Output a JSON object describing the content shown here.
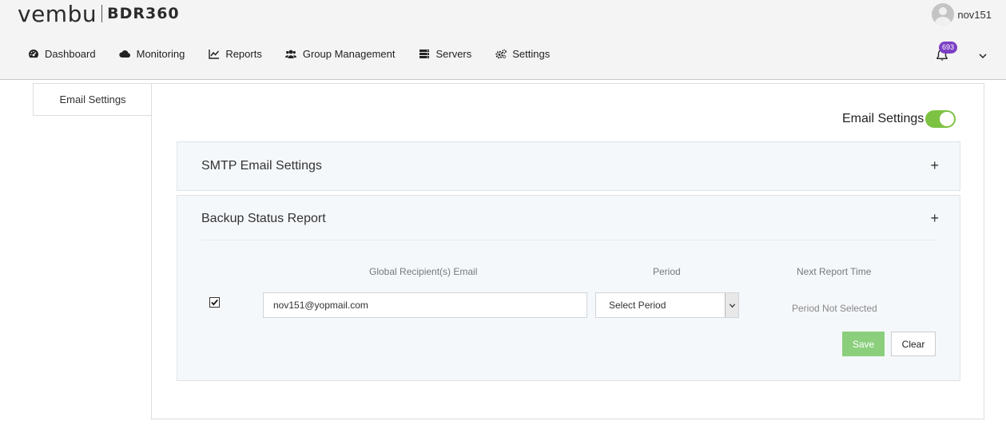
{
  "brand": {
    "logo": "vembu",
    "product": "BDR360"
  },
  "user": {
    "name": "nov151"
  },
  "nav": {
    "items": [
      {
        "label": "Dashboard",
        "icon": "dashboard-icon"
      },
      {
        "label": "Monitoring",
        "icon": "cloud-icon"
      },
      {
        "label": "Reports",
        "icon": "chart-line-icon"
      },
      {
        "label": "Group Management",
        "icon": "users-icon"
      },
      {
        "label": "Servers",
        "icon": "server-icon"
      },
      {
        "label": "Settings",
        "icon": "cogs-icon"
      }
    ]
  },
  "notifications": {
    "count": "693"
  },
  "sidebar": {
    "tab_label": "Email Settings"
  },
  "main": {
    "email_settings_label": "Email Settings",
    "email_settings_enabled": true,
    "smtp_panel": {
      "title": "SMTP Email Settings",
      "expand": "+"
    },
    "backup_panel": {
      "title": "Backup Status Report",
      "expand": "+",
      "columns": {
        "email": "Global Recipient(s) Email",
        "period": "Period",
        "next": "Next Report Time"
      },
      "row": {
        "checked": true,
        "email_value": "nov151@yopmail.com",
        "period_value": "Select Period",
        "next_time": "Period Not Selected"
      },
      "save_label": "Save",
      "clear_label": "Clear"
    }
  },
  "colors": {
    "toggle_on": "#7dc242",
    "badge": "#7b3fc4",
    "save_button": "#8bcf7c"
  }
}
